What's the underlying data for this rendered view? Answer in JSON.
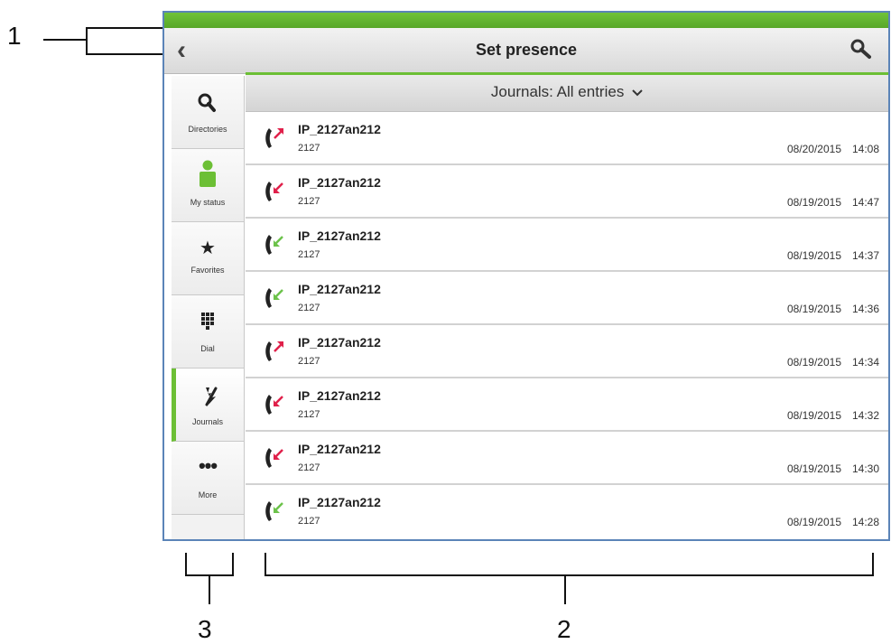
{
  "annotations": {
    "label_1": "1",
    "label_2": "2",
    "label_3": "3"
  },
  "header": {
    "title": "Set presence",
    "back_icon": "back-arrow-icon",
    "search_icon": "search-icon"
  },
  "sidebar": {
    "items": [
      {
        "label": "Directories",
        "icon": "search-icon",
        "active": false
      },
      {
        "label": "My status",
        "icon": "person-icon",
        "active": false
      },
      {
        "label": "Favorites",
        "icon": "star-icon",
        "active": false
      },
      {
        "label": "Dial",
        "icon": "keypad-icon",
        "active": false
      },
      {
        "label": "Journals",
        "icon": "journals-icon",
        "active": true
      },
      {
        "label": "More",
        "icon": "more-icon",
        "active": false
      }
    ]
  },
  "filter": {
    "label": "Journals: All entries",
    "chevron_icon": "chevron-down-icon"
  },
  "journal": {
    "entries": [
      {
        "name": "IP_2127an212",
        "number": "2127",
        "date": "08/20/2015",
        "time": "14:08",
        "type": "outgoing"
      },
      {
        "name": "IP_2127an212",
        "number": "2127",
        "date": "08/19/2015",
        "time": "14:47",
        "type": "missed"
      },
      {
        "name": "IP_2127an212",
        "number": "2127",
        "date": "08/19/2015",
        "time": "14:37",
        "type": "incoming"
      },
      {
        "name": "IP_2127an212",
        "number": "2127",
        "date": "08/19/2015",
        "time": "14:36",
        "type": "incoming"
      },
      {
        "name": "IP_2127an212",
        "number": "2127",
        "date": "08/19/2015",
        "time": "14:34",
        "type": "outgoing"
      },
      {
        "name": "IP_2127an212",
        "number": "2127",
        "date": "08/19/2015",
        "time": "14:32",
        "type": "missed"
      },
      {
        "name": "IP_2127an212",
        "number": "2127",
        "date": "08/19/2015",
        "time": "14:30",
        "type": "missed"
      },
      {
        "name": "IP_2127an212",
        "number": "2127",
        "date": "08/19/2015",
        "time": "14:28",
        "type": "incoming"
      }
    ]
  },
  "colors": {
    "accent_green": "#6cbf35",
    "frame_blue": "#5b84b8",
    "arrow_red": "#e0204a",
    "arrow_green": "#6cc24a"
  }
}
